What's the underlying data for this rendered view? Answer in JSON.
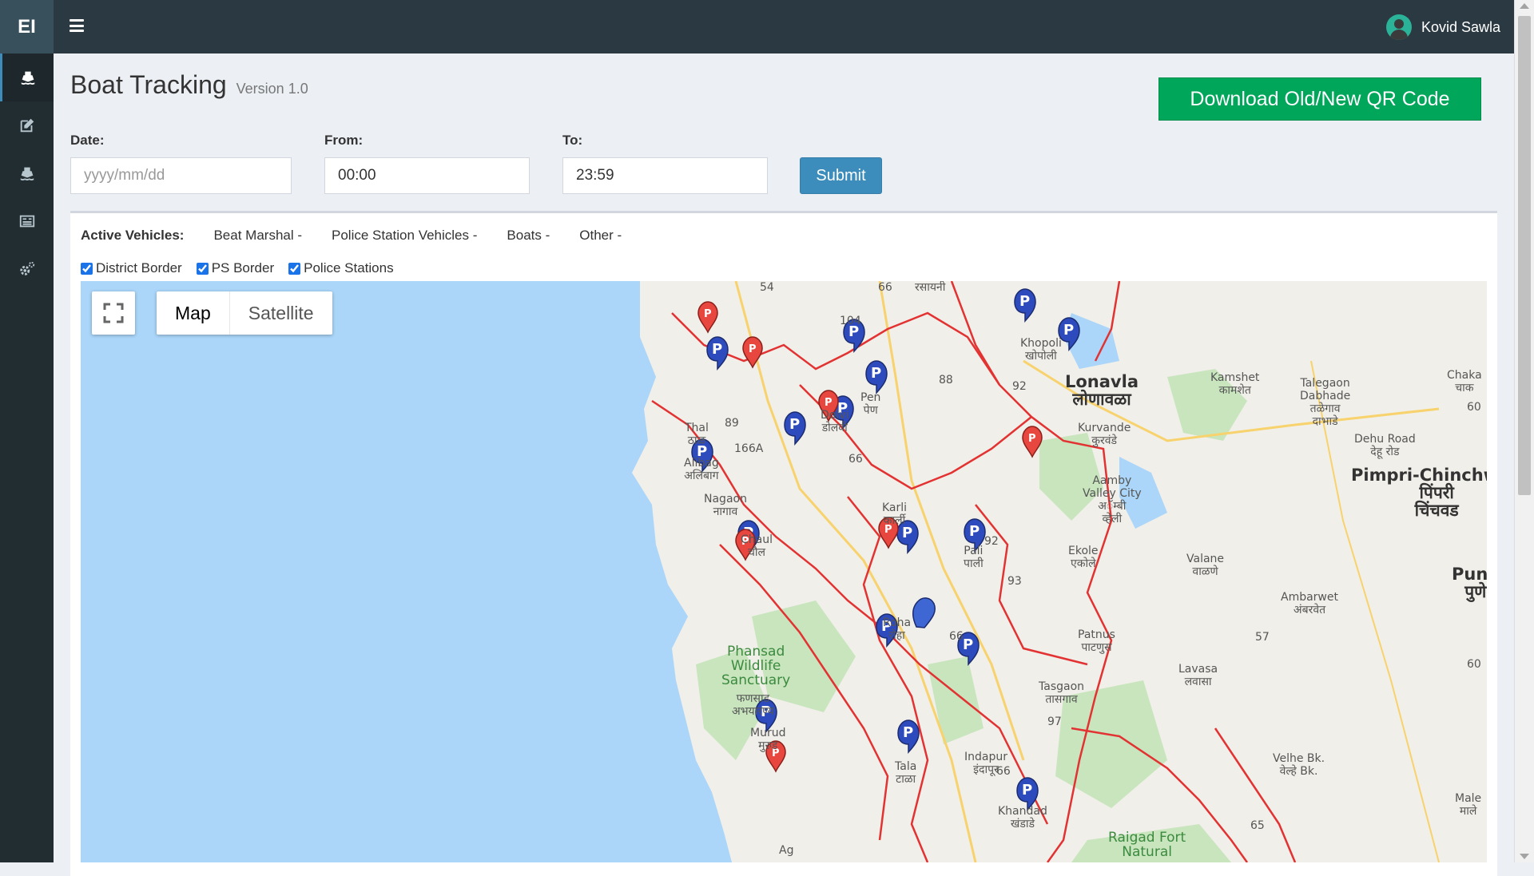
{
  "header": {
    "logo": "EI",
    "user_name": "Kovid Sawla"
  },
  "sidebar": {
    "items": [
      {
        "icon": "ship-icon",
        "active": true
      },
      {
        "icon": "edit-icon",
        "active": false
      },
      {
        "icon": "ship-icon",
        "active": false
      },
      {
        "icon": "newspaper-icon",
        "active": false
      },
      {
        "icon": "cogs-icon",
        "active": false
      }
    ]
  },
  "page": {
    "title": "Boat Tracking",
    "version": "Version 1.0",
    "qr_button": "Download Old/New QR Code"
  },
  "form": {
    "date_label": "Date:",
    "date_placeholder": "yyyy/mm/dd",
    "from_label": "From:",
    "from_value": "00:00",
    "to_label": "To:",
    "to_value": "23:59",
    "submit": "Submit"
  },
  "active": {
    "label": "Active Vehicles:",
    "stats": [
      "Beat Marshal -",
      "Police Station Vehicles -",
      "Boats -",
      "Other -"
    ]
  },
  "toggles": [
    {
      "label": "District Border",
      "checked": true
    },
    {
      "label": "PS Border",
      "checked": true
    },
    {
      "label": "Police Stations",
      "checked": true
    }
  ],
  "map": {
    "type_map": "Map",
    "type_satellite": "Satellite",
    "places": [
      {
        "t": "Lonavla\nलोणावळा"
      },
      {
        "t": "Kamshet\nकामशेत"
      },
      {
        "t": "Talegaon\nDabhade\nतळेगाव\nदाभाडे"
      },
      {
        "t": "Chaka\nचाक"
      },
      {
        "t": "Kurvande\nकुरवंडे"
      },
      {
        "t": "Dehu Road\nदेहू रोड"
      },
      {
        "t": "Pimpri-Chinchwad\nपिंपरी\nचिंचवड"
      },
      {
        "t": "Aamby\nValley City\nअॅम्बी\nव्हेली"
      },
      {
        "t": "Thal\nठाळ"
      },
      {
        "t": "Alibag\nअलिबाग"
      },
      {
        "t": "Nagaon\nनागाव"
      },
      {
        "t": "Chaul\nचौल"
      },
      {
        "t": "Karli\nकार्ली"
      },
      {
        "t": "Pali\nपाली"
      },
      {
        "t": "Ekole\nएकोले"
      },
      {
        "t": "Valane\nवाळणे"
      },
      {
        "t": "Pune\nपुणे"
      },
      {
        "t": "Ambarwet\nअंबरवेत"
      },
      {
        "t": "Roha\nरोहा"
      },
      {
        "t": "Patnus\nपाटणुस"
      },
      {
        "t": "Phansad\nWildlife\nSanctuary"
      },
      {
        "t": "फणसाड\nअभयारण्य"
      },
      {
        "t": "Lavasa\nलवासा"
      },
      {
        "t": "Tasgaon\nतासगाव"
      },
      {
        "t": "Murud\nमुरुड"
      },
      {
        "t": "Tala\nटाळा"
      },
      {
        "t": "Indapur\nइंदापूर"
      },
      {
        "t": "Khandad\nखंडाडे"
      },
      {
        "t": "Velhe Bk.\nवेल्हे Bk."
      },
      {
        "t": "Male\nमाले"
      },
      {
        "t": "Raigad Fort\nNatural"
      },
      {
        "t": "Pen\nपेण"
      },
      {
        "t": "Dolvi\nडोलवी"
      },
      {
        "t": "Khopoli\nखोपोली"
      },
      {
        "t": "Ag"
      },
      {
        "t": "रसायनी"
      }
    ],
    "roads": [
      "54",
      "66",
      "104",
      "88",
      "92",
      "89",
      "166A",
      "66",
      "92",
      "93",
      "66",
      "57",
      "60",
      "60",
      "97",
      "66",
      "65"
    ]
  }
}
